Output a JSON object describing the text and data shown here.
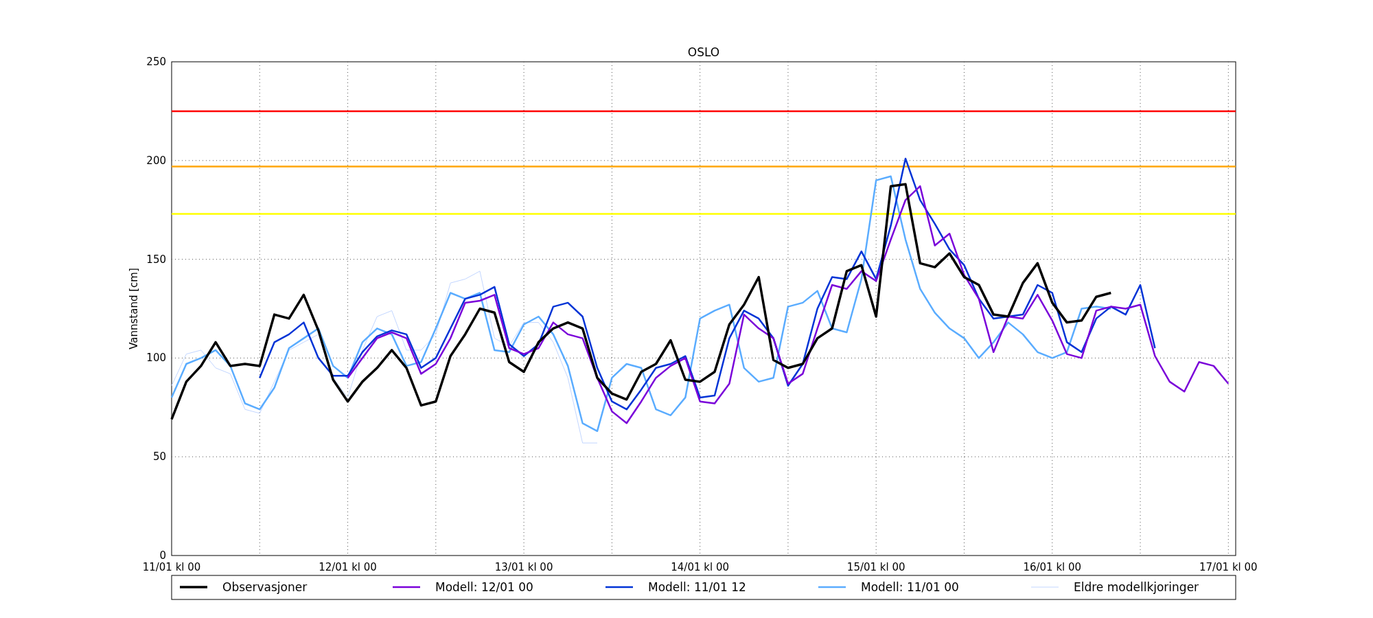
{
  "chart_data": {
    "type": "line",
    "title": "OSLO",
    "ylabel": "Vannstand [cm]",
    "categories": [
      "11/01 kl 00",
      null,
      null,
      null,
      null,
      null,
      null,
      null,
      null,
      null,
      null,
      null,
      "12/01 kl 00",
      null,
      null,
      null,
      null,
      null,
      null,
      null,
      null,
      null,
      null,
      null,
      "13/01 kl 00",
      null,
      null,
      null,
      null,
      null,
      null,
      null,
      null,
      null,
      null,
      null,
      "14/01 kl 00",
      null,
      null,
      null,
      null,
      null,
      null,
      null,
      null,
      null,
      null,
      null,
      "15/01 kl 00",
      null,
      null,
      null,
      null,
      null,
      null,
      null,
      null,
      null,
      null,
      null,
      "16/01 kl 00",
      null,
      null,
      null,
      null,
      null,
      null,
      null,
      null,
      null,
      null,
      null,
      "17/01 kl 00"
    ],
    "ylim": [
      0,
      250
    ],
    "grid": true,
    "legend": "bottom",
    "yticks": [
      0,
      50,
      100,
      150,
      200,
      250
    ],
    "series": [
      {
        "name": "Observasjoner",
        "color": "#000000",
        "values": [
          69,
          88,
          96,
          108,
          96,
          97,
          96,
          122,
          120,
          132,
          114,
          89,
          78,
          88,
          95,
          104,
          95,
          76,
          78,
          101,
          112,
          125,
          123,
          98,
          93,
          108,
          115,
          118,
          115,
          90,
          82,
          79,
          93,
          97,
          109,
          89,
          88,
          93,
          117,
          127,
          141,
          99,
          95,
          97,
          110,
          115,
          144,
          147,
          121,
          187,
          188,
          148,
          146,
          153,
          141,
          137,
          122,
          121,
          138,
          148,
          128,
          118,
          119,
          131,
          133,
          null,
          null,
          null,
          null,
          null,
          null,
          null,
          null
        ]
      },
      {
        "name": "Modell: 12/01 00",
        "color": "#7a00d9",
        "values": [
          null,
          null,
          null,
          null,
          null,
          null,
          null,
          null,
          null,
          null,
          null,
          null,
          90,
          100,
          110,
          113,
          110,
          92,
          97,
          110,
          128,
          129,
          132,
          105,
          102,
          105,
          118,
          112,
          110,
          90,
          73,
          67,
          78,
          90,
          96,
          100,
          78,
          77,
          87,
          122,
          115,
          110,
          87,
          92,
          115,
          137,
          135,
          144,
          139,
          160,
          180,
          187,
          157,
          163,
          142,
          130,
          103,
          121,
          120,
          132,
          119,
          102,
          100,
          124,
          126,
          125,
          127,
          101,
          88,
          83,
          98,
          96,
          87
        ]
      },
      {
        "name": "Modell: 11/01 12",
        "color": "#0033d6",
        "values": [
          null,
          null,
          null,
          null,
          null,
          null,
          90,
          108,
          112,
          118,
          100,
          91,
          91,
          103,
          111,
          114,
          112,
          95,
          100,
          115,
          130,
          132,
          136,
          107,
          101,
          107,
          126,
          128,
          121,
          95,
          78,
          74,
          84,
          95,
          97,
          101,
          80,
          81,
          110,
          124,
          120,
          110,
          86,
          97,
          125,
          141,
          140,
          154,
          140,
          167,
          201,
          180,
          168,
          155,
          147,
          130,
          120,
          121,
          122,
          137,
          133,
          108,
          103,
          120,
          126,
          122,
          137,
          105,
          null,
          null,
          null,
          null,
          null
        ]
      },
      {
        "name": "Modell: 11/01 00",
        "color": "#5aacff",
        "values": [
          80,
          97,
          100,
          104,
          96,
          77,
          74,
          85,
          105,
          110,
          115,
          96,
          90,
          108,
          115,
          112,
          96,
          98,
          115,
          133,
          130,
          133,
          104,
          103,
          117,
          121,
          112,
          96,
          67,
          63,
          90,
          97,
          95,
          74,
          71,
          80,
          120,
          124,
          127,
          95,
          88,
          90,
          126,
          128,
          134,
          115,
          113,
          140,
          190,
          192,
          160,
          135,
          123,
          115,
          110,
          100,
          108,
          118,
          112,
          103,
          100,
          103,
          125,
          126,
          125,
          null,
          null,
          null,
          null,
          null,
          null,
          null,
          null
        ]
      },
      {
        "name": "Eldre modellkjoringer",
        "color": "#c2d6ff",
        "values": [
          86,
          102,
          104,
          95,
          92,
          74,
          72,
          88,
          104,
          108,
          112,
          90,
          80,
          104,
          121,
          124,
          104,
          104,
          112,
          138,
          140,
          144,
          110,
          106,
          118,
          118,
          108,
          90,
          57,
          57,
          null,
          null,
          null,
          null,
          null,
          null,
          null,
          null,
          null,
          null,
          null,
          null,
          null,
          null,
          null,
          null,
          null,
          null,
          null,
          null,
          null,
          null,
          null,
          null,
          null,
          null,
          null,
          null,
          null,
          null,
          null,
          null,
          null,
          null,
          null,
          null,
          null,
          null,
          null,
          null,
          null,
          null,
          null
        ]
      }
    ],
    "ref_lines": [
      {
        "axis": "y",
        "value": 225,
        "color": "#ff0000"
      },
      {
        "axis": "y",
        "value": 197,
        "color": "#ffa500"
      },
      {
        "axis": "y",
        "value": 173,
        "color": "#ffff00"
      }
    ]
  }
}
